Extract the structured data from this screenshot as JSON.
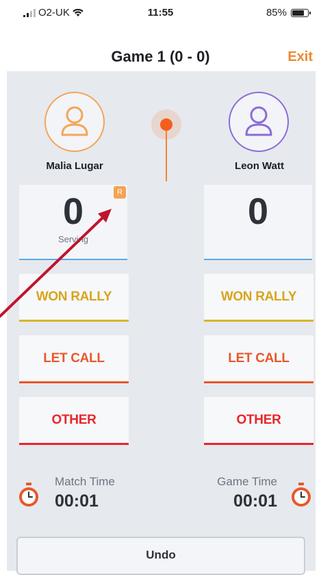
{
  "status_bar": {
    "carrier": "O2-UK",
    "time": "11:55",
    "battery": "85%",
    "battery_level": 0.85
  },
  "header": {
    "title": "Game 1 (0 - 0)",
    "exit_label": "Exit"
  },
  "players": {
    "left": {
      "name": "Malia Lugar",
      "score": "0",
      "status": "Serving",
      "badge": "R",
      "accent": "#f3a559"
    },
    "right": {
      "name": "Leon Watt",
      "score": "0",
      "accent": "#8b6cd9"
    }
  },
  "actions": {
    "won_rally": "WON RALLY",
    "let_call": "LET CALL",
    "other": "OTHER"
  },
  "timers": {
    "match_label": "Match Time",
    "match_value": "00:01",
    "game_label": "Game Time",
    "game_value": "00:01"
  },
  "undo_label": "Undo",
  "colors": {
    "accent_orange": "#f0872f",
    "won_rally": "#d8a41c",
    "let_call": "#e8572a",
    "other": "#e8262a",
    "score_underline": "#5aa9e6",
    "annotation_arrow": "#c0142b"
  }
}
